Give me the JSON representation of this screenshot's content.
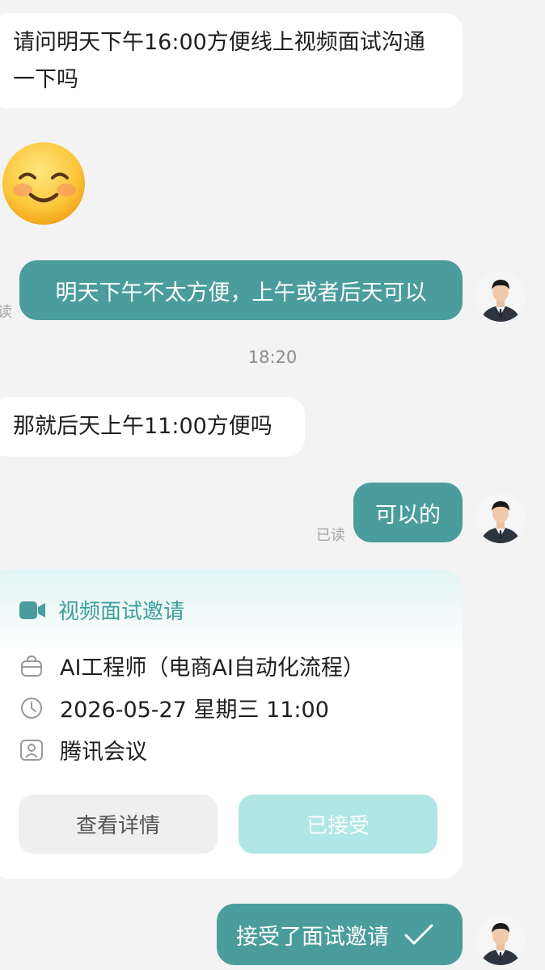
{
  "messages": {
    "m1": "请问明天下午16:00方便线上视频面试沟通一下吗",
    "m2": "明天下午不太方便，上午或者后天可以",
    "m2_read": "读",
    "timestamp": "18:20",
    "m3": "那就后天上午11:00方便吗",
    "m4": "可以的",
    "m4_read": "已读",
    "m5": "接受了面试邀请"
  },
  "emoji": {
    "icon": "smiling-face-icon"
  },
  "invite_card": {
    "title": "视频面试邀请",
    "position": "AI工程师（电商AI自动化流程）",
    "datetime": "2026-05-27 星期三 11:00",
    "platform": "腾讯会议",
    "details_button": "查看详情",
    "accepted_button": "已接受"
  },
  "colors": {
    "accent": "#4a9d9c",
    "accent_text": "#3d9e9d",
    "accepted_bg": "#b0e6e6",
    "background": "#f3f3f3"
  }
}
